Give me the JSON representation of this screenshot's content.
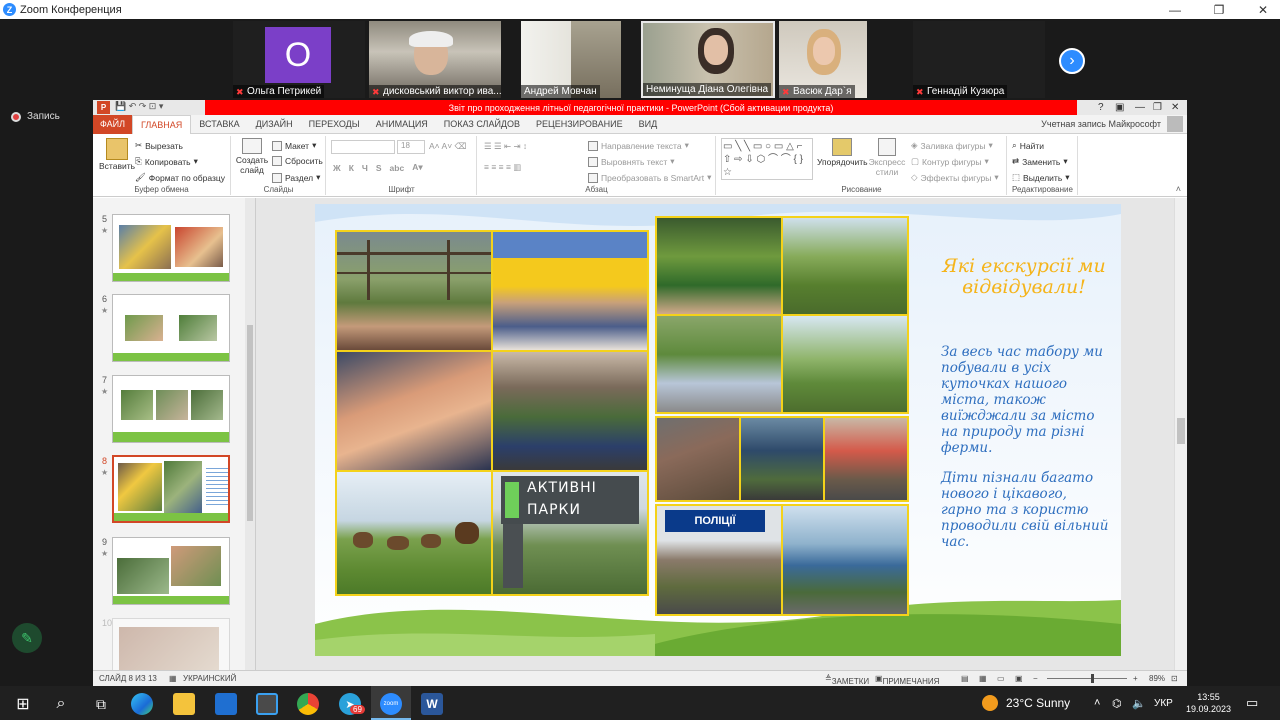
{
  "zoom": {
    "window_title": "Zoom Конференция",
    "record_label": "Запись",
    "participants": [
      {
        "name": "Ольга Петрикей",
        "avatar_letter": "O"
      },
      {
        "name": "дисковський виктор ива..."
      },
      {
        "name": "Андрей Мовчан"
      },
      {
        "name": "Неминуща Діана Олегівна"
      },
      {
        "name": "Васюк Дар`я"
      },
      {
        "name": "Геннадій Кузюра"
      }
    ]
  },
  "ppt": {
    "title": "Звіт про проходження літньої педагогічної  практики -  PowerPoint (Сбой активации продукта)",
    "menu": {
      "file": "ФАЙЛ",
      "tabs": [
        "ГЛАВНАЯ",
        "ВСТАВКА",
        "ДИЗАЙН",
        "ПЕРЕХОДЫ",
        "АНИМАЦИЯ",
        "ПОКАЗ СЛАЙДОВ",
        "РЕЦЕНЗИРОВАНИЕ",
        "ВИД"
      ],
      "account": "Учетная запись Майкрософт"
    },
    "ribbon": {
      "clipboard": {
        "paste": "Вставить",
        "cut": "Вырезать",
        "copy": "Копировать",
        "format_painter": "Формат по образцу",
        "group": "Буфер обмена"
      },
      "slides": {
        "new_slide": "Создать слайд",
        "layout": "Макет",
        "reset": "Сбросить",
        "section": "Раздел",
        "group": "Слайды"
      },
      "font": {
        "size": "18",
        "group": "Шрифт",
        "bold": "Ж",
        "italic": "К",
        "underline": "Ч",
        "strike": "S",
        "spacing": "abc"
      },
      "paragraph": {
        "text_direction": "Направление текста",
        "align_text": "Выровнять текст",
        "smartart": "Преобразовать в SmartArt",
        "group": "Абзац"
      },
      "drawing": {
        "arrange": "Упорядочить",
        "quick_styles": "Экспресс стили",
        "shape_fill": "Заливка фигуры",
        "shape_outline": "Контур фигуры",
        "shape_effects": "Эффекты фигуры",
        "group": "Рисование"
      },
      "editing": {
        "find": "Найти",
        "replace": "Заменить",
        "select": "Выделить",
        "group": "Редактирование"
      }
    },
    "thumbnails": [
      {
        "num": "5",
        "star": "★"
      },
      {
        "num": "6",
        "star": "★"
      },
      {
        "num": "7",
        "star": "★"
      },
      {
        "num": "8",
        "star": "★"
      },
      {
        "num": "9",
        "star": "★"
      },
      {
        "num": "10",
        "star": ""
      }
    ],
    "slide": {
      "heading": "Які екскурсії ми відвідували!",
      "para1": "За весь час табору ми побували в усіх куточках нашого міста, також виїжджали за місто на природу та різні ферми.",
      "para2": "Діти пізнали багато нового і цікавого, гарно та з користю проводили свій вільний час.",
      "sign1": "АКТИВНІ",
      "sign2": "ПАРКИ",
      "police": "ПОЛІЦІЇ"
    },
    "status": {
      "slide_info": "СЛАЙД 8 ИЗ 13",
      "language": "УКРАИНСКИЙ",
      "notes": "ЗАМЕТКИ",
      "comments": "ПРИМЕЧАНИЯ",
      "zoom": "89%"
    }
  },
  "taskbar": {
    "weather": "23°C  Sunny",
    "lang": "УКР",
    "time": "13:55",
    "date": "19.09.2023",
    "telegram_badge": "69",
    "zoom_label": "zoom"
  }
}
